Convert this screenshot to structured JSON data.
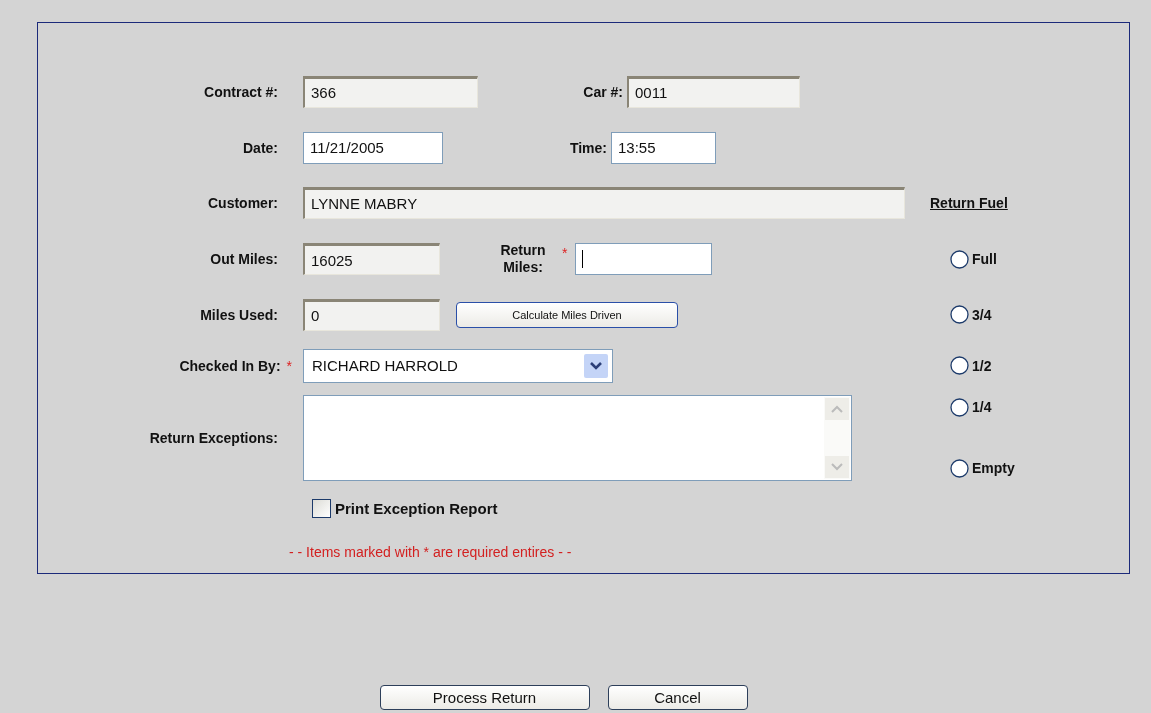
{
  "contract": {
    "label": "Contract #:",
    "value": "366",
    "readonly": true
  },
  "car": {
    "label": "Car #:",
    "value": "0011",
    "readonly": true
  },
  "date": {
    "label": "Date:",
    "value": "11/21/2005",
    "readonly": false
  },
  "time": {
    "label": "Time:",
    "value": "13:55",
    "readonly": false
  },
  "customer": {
    "label": "Customer:",
    "value": "LYNNE MABRY",
    "readonly": true
  },
  "out_miles": {
    "label": "Out Miles:",
    "value": "16025",
    "readonly": true
  },
  "return_miles": {
    "label": "Return Miles:",
    "marker": "*",
    "focused": true
  },
  "miles_used": {
    "label": "Miles Used:",
    "value": "0",
    "readonly": true
  },
  "calculate_button": "Calculate Miles Driven",
  "checked_in_by": {
    "label": "Checked In By:",
    "marker": "*",
    "value": "RICHARD HARROLD"
  },
  "return_exceptions": {
    "label": "Return Exceptions:"
  },
  "print_exception_report": {
    "label": "Print Exception Report",
    "checked": false
  },
  "required_note": "- - Items marked with * are required entires - -",
  "return_fuel": {
    "title": "Return Fuel",
    "options": [
      {
        "label": "Full",
        "selected": false
      },
      {
        "label": "3/4",
        "selected": false
      },
      {
        "label": "1/2",
        "selected": false
      },
      {
        "label": "1/4",
        "selected": false
      },
      {
        "label": "Empty",
        "selected": false
      }
    ]
  },
  "actions": [
    "Process Return",
    "Cancel"
  ]
}
